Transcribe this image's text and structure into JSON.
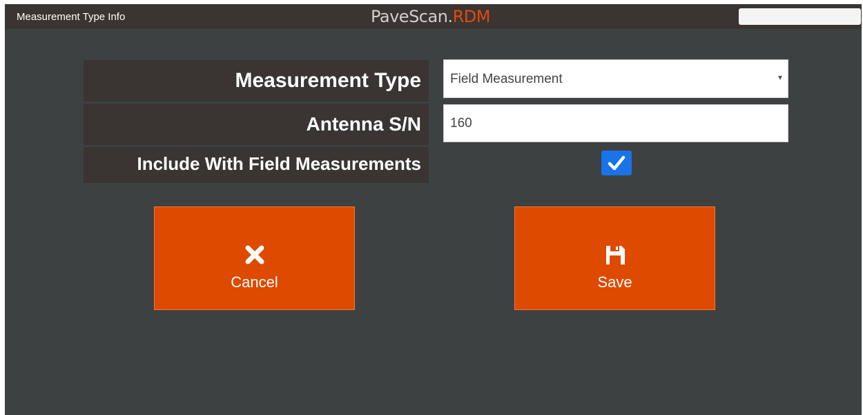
{
  "header": {
    "title": "Measurement Type Info",
    "brand_main": "PaveScan",
    "brand_dot": ".",
    "brand_accent": "RDM"
  },
  "form": {
    "measurement_type_label": "Measurement Type",
    "measurement_type_value": "Field Measurement",
    "antenna_sn_label": "Antenna S/N",
    "antenna_sn_value": "160",
    "include_label": "Include With Field Measurements",
    "include_checked": true
  },
  "buttons": {
    "cancel_label": "Cancel",
    "cancel_icon": "close-icon",
    "save_label": "Save",
    "save_icon": "floppy-disk-icon"
  },
  "colors": {
    "background": "#3d4141",
    "header": "#3a3532",
    "accent": "#dd4a00",
    "checkbox": "#1a73e8"
  }
}
